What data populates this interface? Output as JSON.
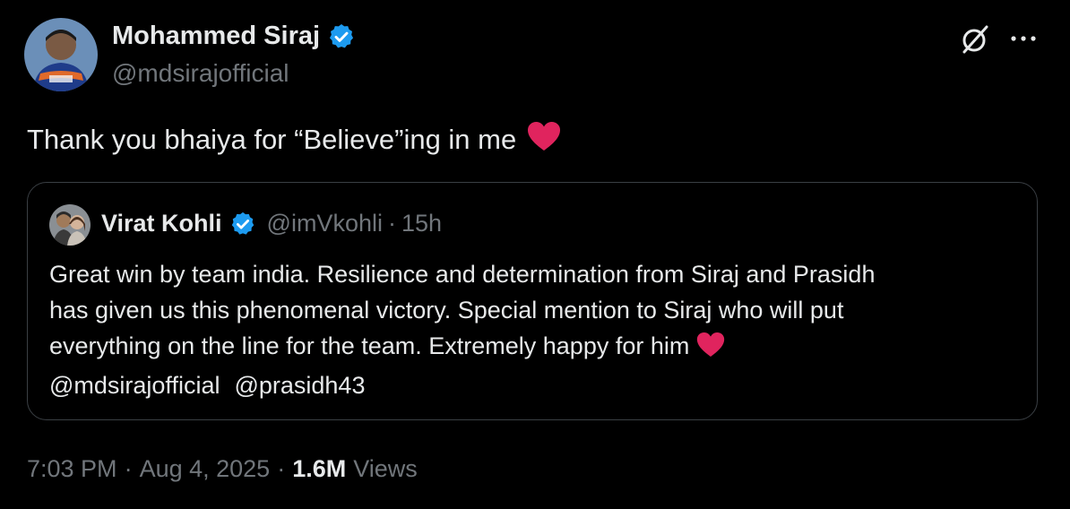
{
  "author": {
    "display_name": "Mohammed Siraj",
    "handle": "@mdsirajofficial",
    "verified": true
  },
  "tweet": {
    "text": "Thank you bhaiya for “Believe”ing in me",
    "emoji": "red-heart"
  },
  "quoted_tweet": {
    "display_name": "Virat Kohli",
    "handle": "@imVkohli",
    "separator": "·",
    "time": "15h",
    "lines": [
      "Great win by team india. Resilience and determination from Siraj and Prasidh",
      "has given us this phenomenal victory. Special mention to Siraj who will put",
      "everything on the line for the team. Extremely happy for him"
    ],
    "mentions": [
      "@mdsirajofficial",
      "@prasidh43"
    ]
  },
  "footer": {
    "time": "7:03 PM",
    "date": "Aug 4, 2025",
    "separator": "·",
    "views_count": "1.6M",
    "views_label": "Views"
  },
  "colors": {
    "background": "#000000",
    "text_primary": "#e7e9ea",
    "text_secondary": "#71767b",
    "verified_blue": "#1d9bf0",
    "heart_red": "#e0245e",
    "border": "#3a3f44"
  },
  "icons": {
    "grok": "grok-icon",
    "more": "more-icon",
    "verified": "verified-badge-icon"
  }
}
